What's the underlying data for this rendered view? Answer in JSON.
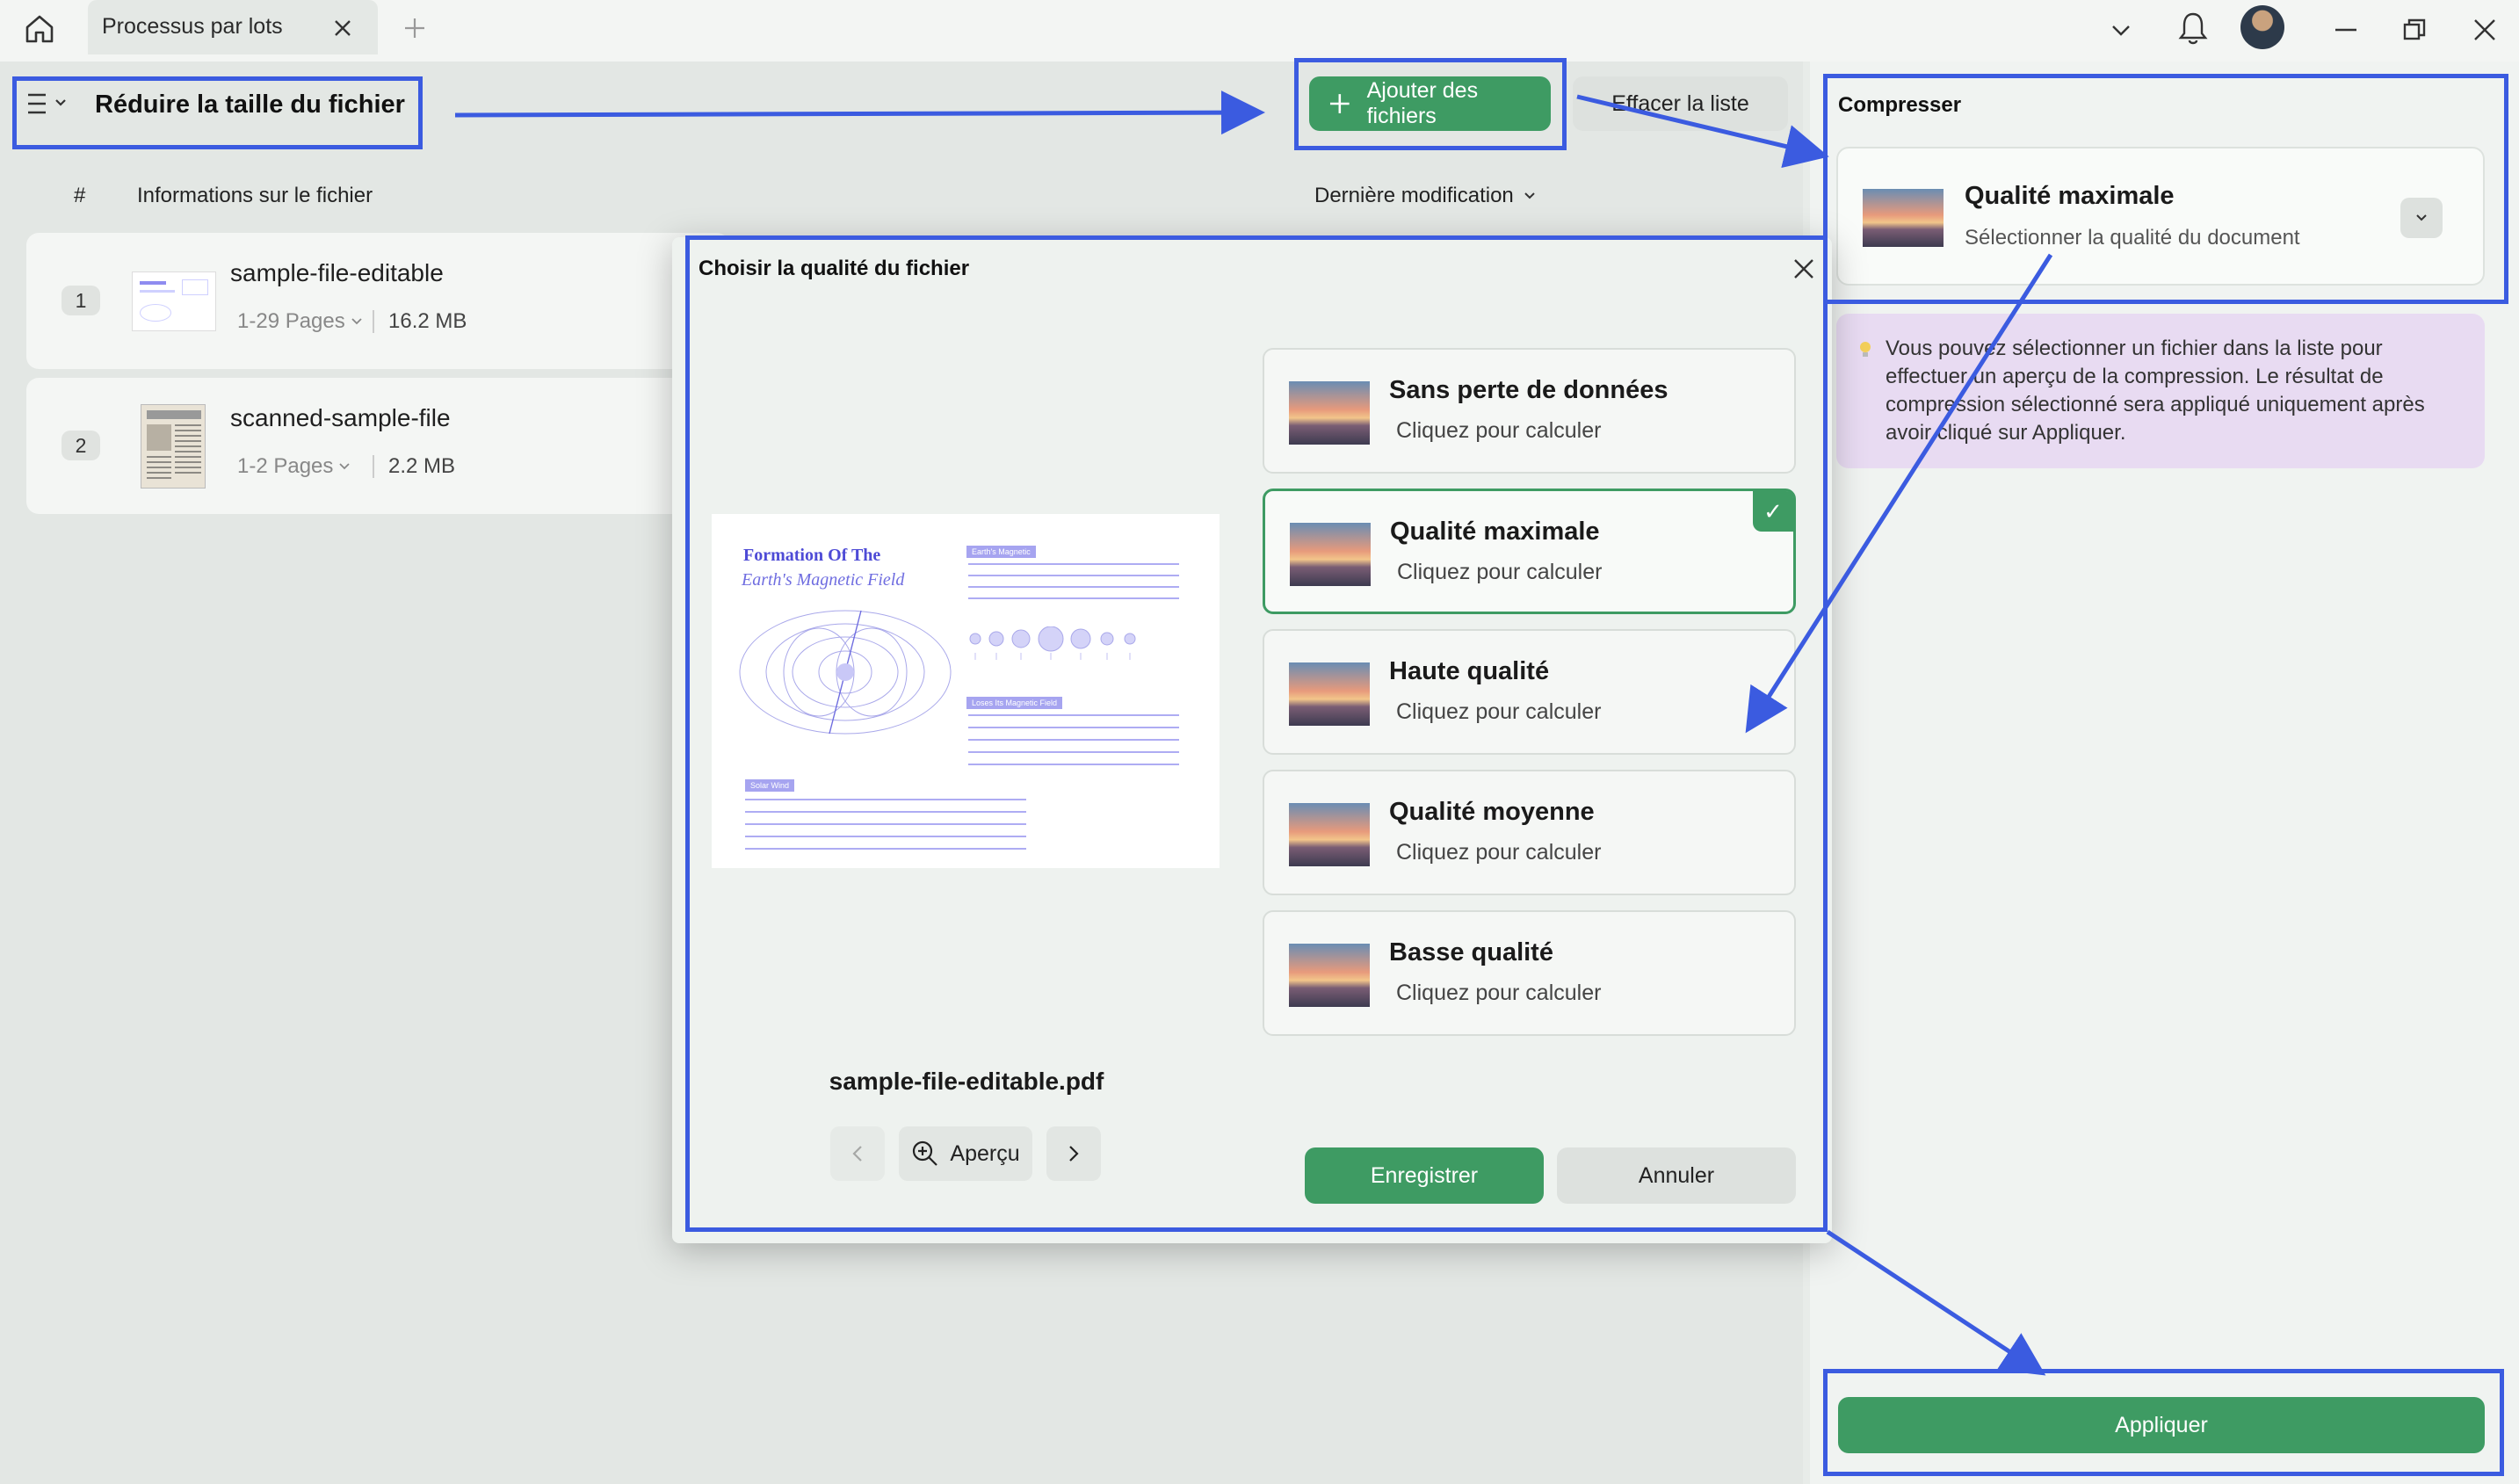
{
  "window": {
    "tab_title": "Processus par lots"
  },
  "header": {
    "title": "Réduire la taille du fichier",
    "add_files_label": "Ajouter des fichiers",
    "clear_list_label": "Effacer la liste"
  },
  "table": {
    "col_num": "#",
    "col_info": "Informations sur le fichier",
    "col_modified": "Dernière modification"
  },
  "files": [
    {
      "num": "1",
      "name": "sample-file-editable",
      "pages": "1-29 Pages",
      "size": "16.2 MB"
    },
    {
      "num": "2",
      "name": "scanned-sample-file",
      "pages": "1-2 Pages",
      "size": "2.2 MB"
    }
  ],
  "right_panel": {
    "section_title": "Compresser",
    "quality_title": "Qualité maximale",
    "quality_sub": "Sélectionner la qualité du document",
    "info_text": "Vous pouvez sélectionner un fichier dans la liste pour effectuer un aperçu de la compression. Le résultat de compression sélectionné sera appliqué uniquement après avoir cliqué sur Appliquer.",
    "apply_label": "Appliquer"
  },
  "dialog": {
    "title": "Choisir la qualité du fichier",
    "file_name": "sample-file-editable.pdf",
    "preview_label": "Aperçu",
    "save_label": "Enregistrer",
    "cancel_label": "Annuler",
    "options": [
      {
        "title": "Sans perte de données",
        "sub": "Cliquez pour calculer",
        "selected": false
      },
      {
        "title": "Qualité maximale",
        "sub": "Cliquez pour calculer",
        "selected": true
      },
      {
        "title": "Haute qualité",
        "sub": "Cliquez pour calculer",
        "selected": false
      },
      {
        "title": "Qualité moyenne",
        "sub": "Cliquez pour calculer",
        "selected": false
      },
      {
        "title": "Basse qualité",
        "sub": "Cliquez pour calculer",
        "selected": false
      }
    ],
    "check_glyph": "✓"
  },
  "preview_doc": {
    "title_line1": "Formation Of The",
    "title_line2": "Earth's Magnetic Field",
    "tag1": "Earth's Magnetic",
    "tag2": "Loses Its Magnetic Field",
    "tag3": "Solar Wind"
  },
  "colors": {
    "accent_green": "#3e9b63",
    "annotation_blue": "#3b5be0",
    "info_bg": "#e8dbf2"
  }
}
